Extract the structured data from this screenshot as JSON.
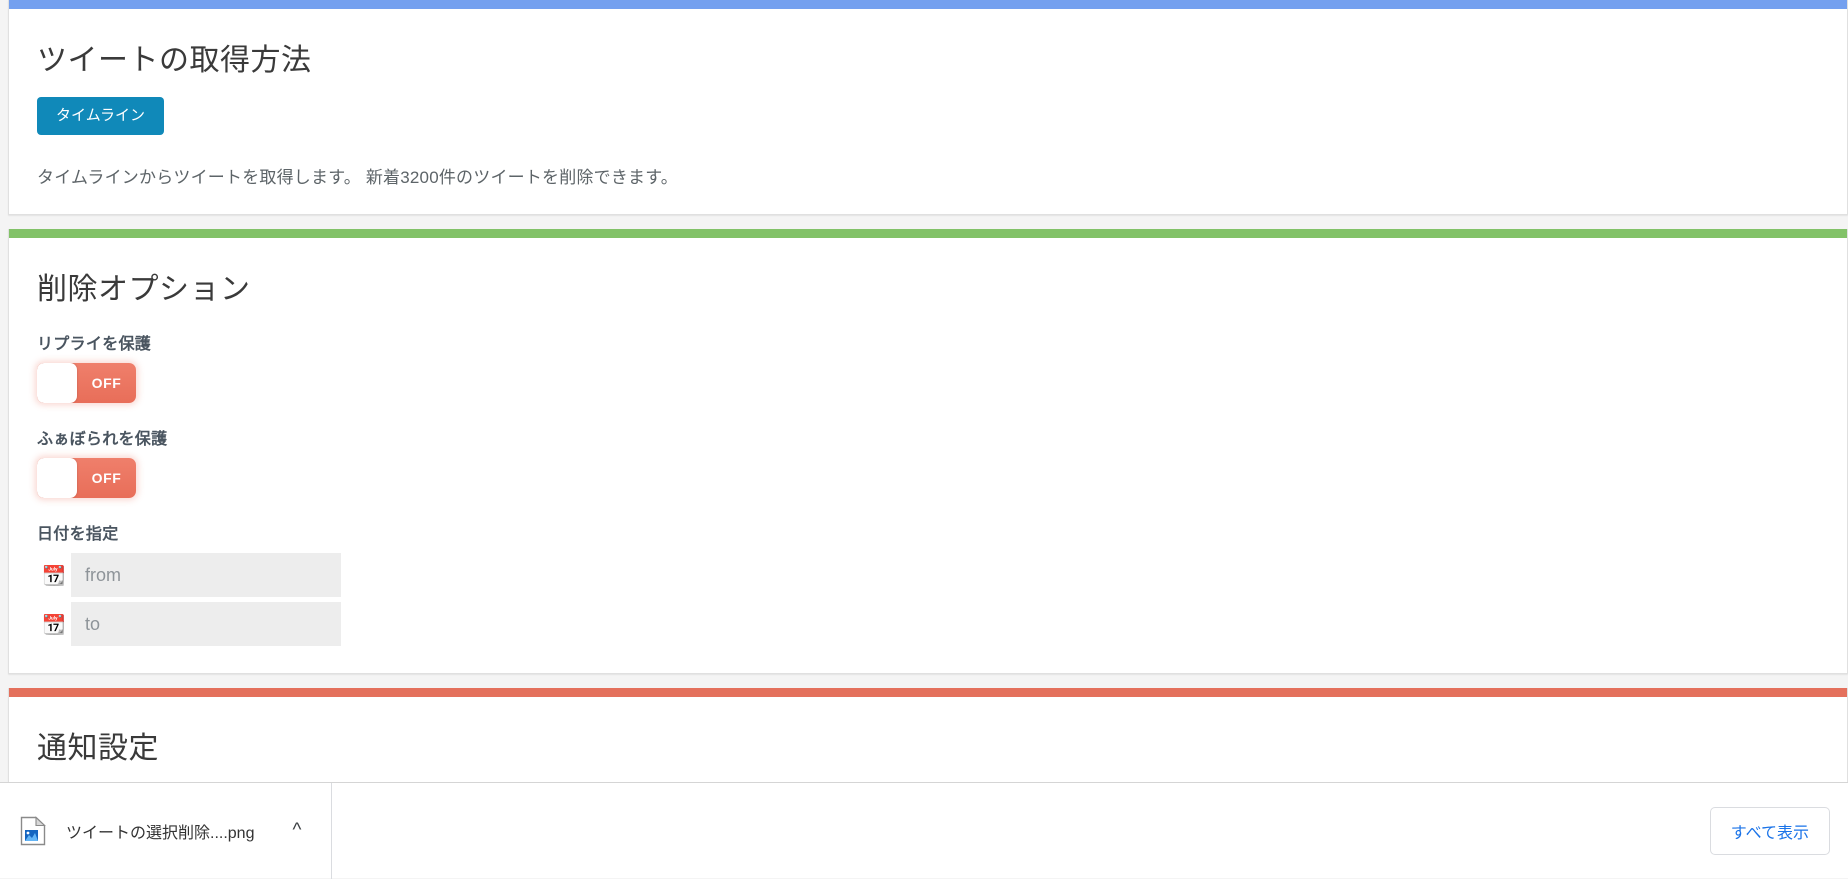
{
  "sections": [
    {
      "id": "fetch-method",
      "accent": "#74a0ef",
      "title": "ツイートの取得方法",
      "button_label": "タイムライン",
      "description": "タイムラインからツイートを取得します。 新着3200件のツイートを削除できます。"
    },
    {
      "id": "delete-options",
      "accent": "#82c268",
      "title": "削除オプション",
      "options": [
        {
          "label": "リプライを保護",
          "state": "OFF"
        },
        {
          "label": "ふぁぼられを保護",
          "state": "OFF"
        }
      ],
      "date_label": "日付を指定",
      "date_fields": [
        {
          "icon": "calendar-icon",
          "placeholder": "from",
          "value": ""
        },
        {
          "icon": "calendar-icon",
          "placeholder": "to",
          "value": ""
        }
      ]
    },
    {
      "id": "notification-settings",
      "accent": "#e4705c",
      "title": "通知設定"
    }
  ],
  "download_shelf": {
    "file_icon": "image-file-icon",
    "filename": "ツイートの選択削除....png",
    "expand_icon": "chevron-up-icon",
    "show_all_label": "すべて表示"
  },
  "colors": {
    "page_background": "#f4f4f4",
    "card_background": "#ffffff",
    "accent_blue": "#74a0ef",
    "accent_green": "#82c268",
    "accent_red": "#e4705c",
    "button_teal": "#1089b9",
    "toggle_off": "#e8705c",
    "link_blue": "#1a73e8"
  }
}
